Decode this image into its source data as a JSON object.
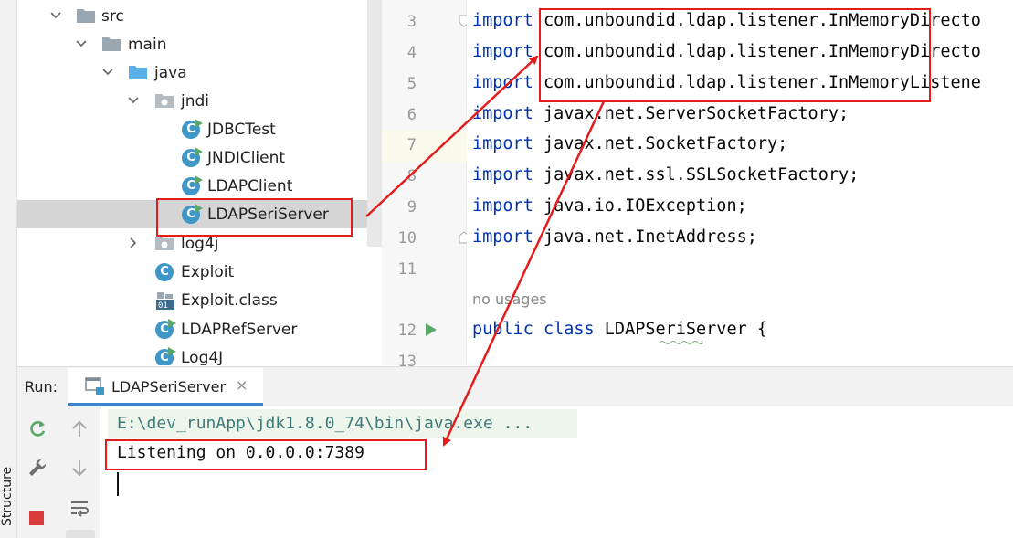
{
  "tree": {
    "items": [
      {
        "label": "src",
        "kind": "folder"
      },
      {
        "label": "main",
        "kind": "folder"
      },
      {
        "label": "java",
        "kind": "source-folder"
      },
      {
        "label": "jndi",
        "kind": "package"
      },
      {
        "label": "JDBCTest",
        "kind": "class-runnable"
      },
      {
        "label": "JNDIClient",
        "kind": "class-runnable"
      },
      {
        "label": "LDAPClient",
        "kind": "class-runnable"
      },
      {
        "label": "LDAPSeriServer",
        "kind": "class-runnable",
        "selected": true
      },
      {
        "label": "log4j",
        "kind": "package"
      },
      {
        "label": "Exploit",
        "kind": "class"
      },
      {
        "label": "Exploit.class",
        "kind": "class-file"
      },
      {
        "label": "LDAPRefServer",
        "kind": "class-runnable"
      },
      {
        "label": "Log4J",
        "kind": "class-runnable"
      }
    ]
  },
  "editor": {
    "lines": [
      {
        "num": "3",
        "kw": "import",
        "rest": " com.unboundid.ldap.listener.InMemoryDirecto"
      },
      {
        "num": "4",
        "kw": "import",
        "rest": " com.unboundid.ldap.listener.InMemoryDirecto"
      },
      {
        "num": "5",
        "kw": "import",
        "rest": " com.unboundid.ldap.listener.InMemoryListene"
      },
      {
        "num": "6",
        "kw": "import",
        "rest": " javax.net.ServerSocketFactory;"
      },
      {
        "num": "7",
        "kw": "import",
        "rest": " javax.net.SocketFactory;"
      },
      {
        "num": "8",
        "kw": "import",
        "rest": " javax.net.ssl.SSLSocketFactory;"
      },
      {
        "num": "9",
        "kw": "import",
        "rest": " java.io.IOException;"
      },
      {
        "num": "10",
        "kw": "import",
        "rest": " java.net.InetAddress;"
      },
      {
        "num": "11",
        "kw": "",
        "rest": ""
      },
      {
        "num": "12",
        "kw": "public class",
        "rest": " LDAPSeriServer {"
      },
      {
        "num": "13",
        "kw": "",
        "rest": ""
      }
    ],
    "usages_hint": "no usages"
  },
  "run": {
    "label": "Run:",
    "tab_label": "LDAPSeriServer",
    "tab_close": "×",
    "console": {
      "command": "E:\\dev_runApp\\jdk1.8.0_74\\bin\\java.exe ...",
      "output": "Listening on 0.0.0.0:7389"
    }
  },
  "side_tabs": {
    "structure": "Structure"
  },
  "colors": {
    "keyword": "#0033b3",
    "annotation_red": "#e41c1c",
    "class_icon": "#3f97c7",
    "run_green": "#59a869"
  }
}
